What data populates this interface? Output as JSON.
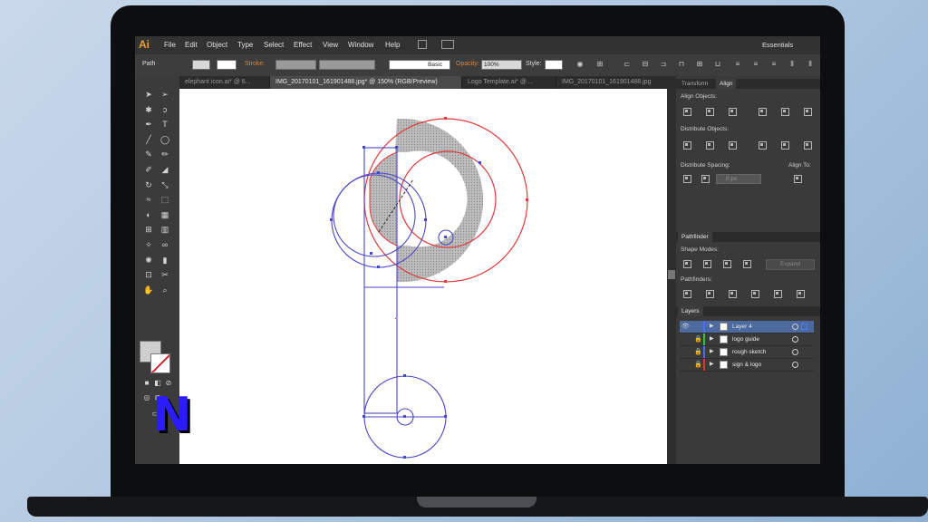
{
  "app": {
    "logo": "Ai",
    "menu": [
      "File",
      "Edit",
      "Object",
      "Type",
      "Select",
      "Effect",
      "View",
      "Window",
      "Help"
    ],
    "workspace": "Essentials"
  },
  "control_bar": {
    "object_type": "Path",
    "stroke_label": "Stroke:",
    "brush_value": "Basic",
    "opacity_label": "Opacity:",
    "opacity_value": "100%",
    "style_label": "Style:"
  },
  "tabs": [
    {
      "label": "elephant icon.ai* @ 6...",
      "active": false
    },
    {
      "label": "IMG_20170101_161901488.jpg* @ 150% (RGB/Preview)",
      "active": true
    },
    {
      "label": "Logo Template.ai* @ ...",
      "active": false
    },
    {
      "label": "IMG_20170101_161901488.jpg",
      "active": false
    }
  ],
  "tools": [
    "selection",
    "direct-selection",
    "magic-wand",
    "lasso",
    "pen",
    "type",
    "line",
    "ellipse",
    "paintbrush",
    "pencil",
    "blob-brush",
    "eraser",
    "rotate",
    "scale",
    "warp",
    "free-transform",
    "shape-builder",
    "perspective",
    "mesh",
    "gradient",
    "eyedropper",
    "blend",
    "symbol-sprayer",
    "column-graph",
    "artboard",
    "slice",
    "hand",
    "zoom"
  ],
  "panels": {
    "top_tabs": [
      "Transform",
      "Align"
    ],
    "align_objects": "Align Objects:",
    "distribute_objects": "Distribute Objects:",
    "distribute_spacing": "Distribute Spacing:",
    "align_to": "Align To:",
    "spacing_value": "0 px",
    "pathfinder_title": "Pathfinder",
    "shape_modes": "Shape Modes:",
    "expand": "Expand",
    "pathfinders": "Pathfinders:",
    "layers_title": "Layers",
    "layers": [
      {
        "name": "Layer 4",
        "color": "#4f6bff",
        "selected": true
      },
      {
        "name": "logo guide",
        "color": "#36c24a",
        "selected": false
      },
      {
        "name": "rough sketch",
        "color": "#4f6bff",
        "selected": false
      },
      {
        "name": "sign & logo",
        "color": "#e03434",
        "selected": false
      }
    ]
  },
  "colors": {
    "accent_orange": "#f09c2d",
    "guide_blue": "#4a46c8",
    "path_red": "#e23a3a",
    "fill_gray": "#a8a8a8"
  },
  "overlay_letter": "N"
}
